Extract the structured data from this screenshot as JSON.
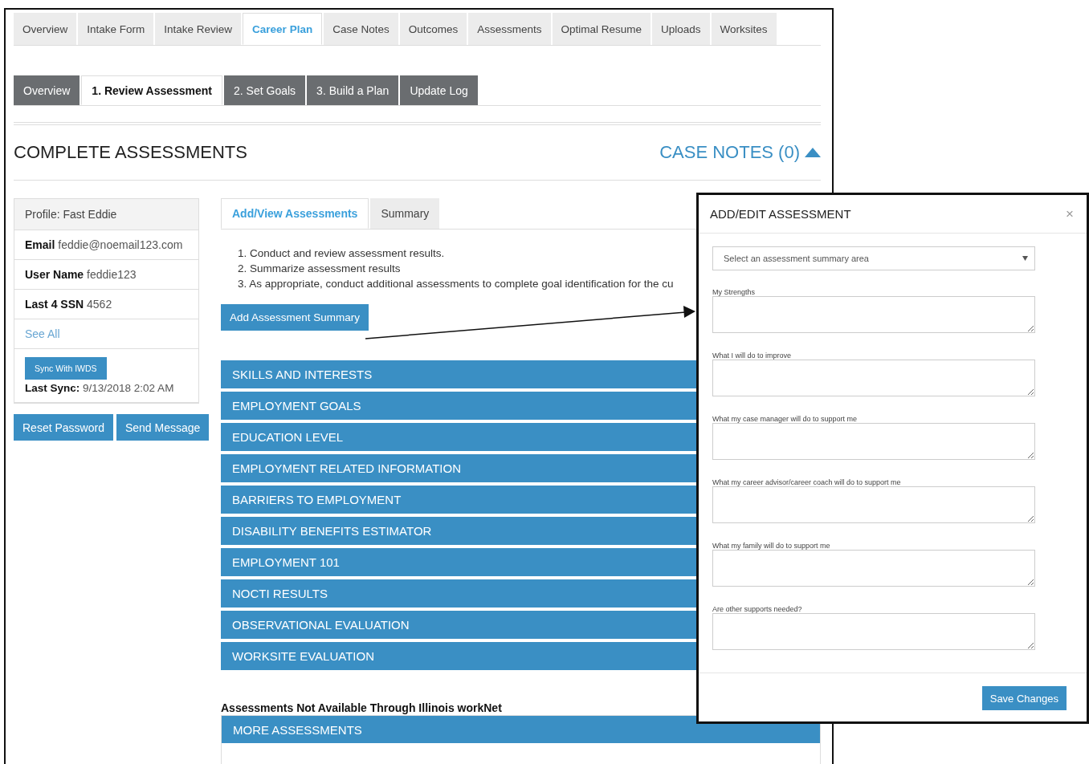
{
  "main_tabs": [
    {
      "label": "Overview",
      "selected": false
    },
    {
      "label": "Intake Form",
      "selected": false
    },
    {
      "label": "Intake Review",
      "selected": false
    },
    {
      "label": "Career Plan",
      "selected": true
    },
    {
      "label": "Case Notes",
      "selected": false
    },
    {
      "label": "Outcomes",
      "selected": false
    },
    {
      "label": "Assessments",
      "selected": false
    },
    {
      "label": "Optimal Resume",
      "selected": false
    },
    {
      "label": "Uploads",
      "selected": false
    },
    {
      "label": "Worksites",
      "selected": false
    }
  ],
  "sub_tabs": [
    {
      "label": "Overview",
      "selected": false
    },
    {
      "label": "1. Review Assessment",
      "selected": true
    },
    {
      "label": "2. Set Goals",
      "selected": false
    },
    {
      "label": "3. Build a Plan",
      "selected": false
    },
    {
      "label": "Update Log",
      "selected": false
    }
  ],
  "section_title": "COMPLETE ASSESSMENTS",
  "case_notes": {
    "label": "CASE NOTES (0)"
  },
  "profile": {
    "title": "Profile: Fast Eddie",
    "fields": [
      "**Email** feddie@noemail123.com",
      "**User Name** feddie123",
      "**Last 4 SSN** 4562"
    ],
    "see_all": "See All",
    "sync_button": "Sync With IWDS",
    "last_sync": "**Last Sync:** 9/13/2018 2:02 AM"
  },
  "profile_buttons": [
    "Reset Password",
    "Send Message"
  ],
  "assessment_tabs": [
    {
      "label": "Add/View Assessments",
      "selected": true
    },
    {
      "label": "Summary",
      "selected": false
    }
  ],
  "instructions": [
    "1. Conduct and review assessment results.",
    "2. Summarize assessment results",
    "3. As appropriate, conduct additional assessments to complete goal identification for the cu"
  ],
  "add_button": "Add Assessment Summary",
  "categories": [
    "SKILLS AND INTERESTS",
    "EMPLOYMENT GOALS",
    "EDUCATION LEVEL",
    "EMPLOYMENT RELATED INFORMATION",
    "BARRIERS TO EMPLOYMENT",
    "DISABILITY BENEFITS ESTIMATOR",
    "EMPLOYMENT 101",
    "NOCTI RESULTS",
    "OBSERVATIONAL EVALUATION",
    "WORKSITE EVALUATION"
  ],
  "more_heading": "Assessments Not Available Through Illinois workNet",
  "more_panel": {
    "title": "MORE ASSESSMENTS"
  },
  "modal": {
    "title": "ADD/EDIT ASSESSMENT",
    "close": "×",
    "select": {
      "placeholder": "Select an assessment summary area"
    },
    "fields": [
      {
        "label": "My Strengths"
      },
      {
        "label": "What I will do to improve"
      },
      {
        "label": "What my case manager will do to support me"
      },
      {
        "label": "What my career advisor/career coach will do to support me"
      },
      {
        "label": "What my family will do to support me"
      },
      {
        "label": "Are other supports needed?"
      }
    ],
    "save_button": "Save Changes"
  }
}
